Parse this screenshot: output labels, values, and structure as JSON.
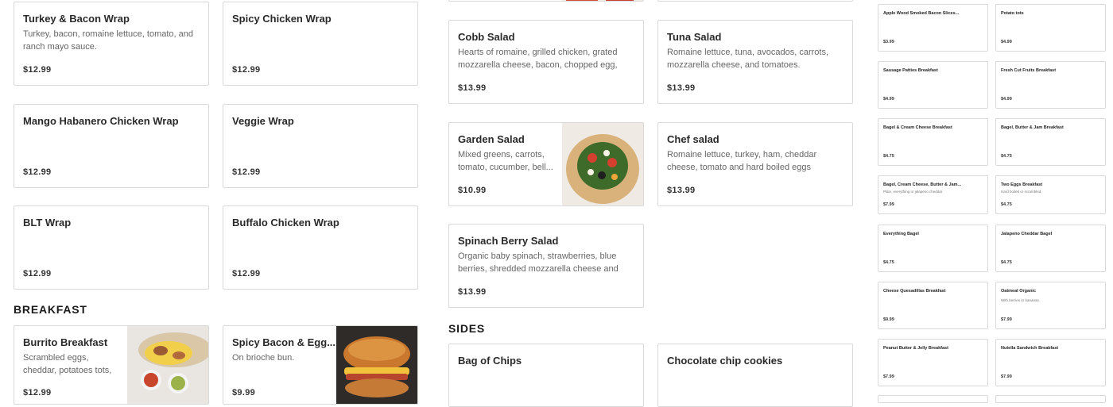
{
  "wraps": [
    {
      "name": "Turkey & Bacon Wrap",
      "desc": "Turkey, bacon, romaine lettuce, tomato, and ranch mayo sauce.",
      "price": "$12.99"
    },
    {
      "name": "Spicy Chicken Wrap",
      "desc": "",
      "price": "$12.99"
    },
    {
      "name": "Mango Habanero Chicken Wrap",
      "desc": "",
      "price": "$12.99"
    },
    {
      "name": "Veggie Wrap",
      "desc": "",
      "price": "$12.99"
    },
    {
      "name": "BLT Wrap",
      "desc": "",
      "price": "$12.99"
    },
    {
      "name": "Buffalo Chicken Wrap",
      "desc": "",
      "price": "$12.99"
    }
  ],
  "breakfast": {
    "heading": "BREAKFAST",
    "items": [
      {
        "name": "Burrito Breakfast",
        "desc": "Scrambled eggs, cheddar, potatoes tots, choice of...",
        "price": "$12.99"
      },
      {
        "name": "Spicy Bacon & Egg...",
        "desc": "On brioche bun.",
        "price": "$9.99"
      }
    ]
  },
  "salads": [
    {
      "name": "Cobb Salad",
      "desc": "Hearts of romaine, grilled chicken, grated mozzarella cheese, bacon, chopped egg, avocad...",
      "price": "$13.99"
    },
    {
      "name": "Tuna Salad",
      "desc": "Romaine lettuce, tuna, avocados, carrots, mozzarella cheese, and tomatoes.",
      "price": "$13.99"
    },
    {
      "name": "Garden Salad",
      "desc": "Mixed greens, carrots, tomato, cucumber, bell...",
      "price": "$10.99"
    },
    {
      "name": "Chef salad",
      "desc": "Romaine lettuce, turkey, ham, cheddar cheese, tomato and hard boiled eggs",
      "price": "$13.99"
    },
    {
      "name": "Spinach Berry Salad",
      "desc": "Organic baby spinach, strawberries, blue berries, shredded mozzarella cheese and almonds.",
      "price": "$13.99"
    }
  ],
  "sides": {
    "heading": "SIDES",
    "items": [
      {
        "name": "Bag of Chips"
      },
      {
        "name": "Chocolate chip cookies"
      }
    ]
  },
  "mini_items": [
    {
      "name": "Apple Wood Smoked Bacon Slices...",
      "desc": "",
      "price": "$3.99"
    },
    {
      "name": "Potato tots",
      "desc": "",
      "price": "$4.99"
    },
    {
      "name": "Sausage Patties Breakfast",
      "desc": "",
      "price": "$4.99"
    },
    {
      "name": "Fresh Cut Fruits Breakfast",
      "desc": "",
      "price": "$4.99"
    },
    {
      "name": "Bagel & Cream Cheese Breakfast",
      "desc": "",
      "price": "$4.75"
    },
    {
      "name": "Bagel, Butter & Jam Breakfast",
      "desc": "",
      "price": "$4.75"
    },
    {
      "name": "Bagel, Cream Cheese, Butter & Jam...",
      "desc": "Plain, everything or jalapeno cheddar.",
      "price": "$7.99"
    },
    {
      "name": "Two Eggs Breakfast",
      "desc": "Hard boiled or scrambled.",
      "price": "$4.75"
    },
    {
      "name": "Everything Bagel",
      "desc": "",
      "price": "$4.75"
    },
    {
      "name": "Jalapeno Cheddar Bagel",
      "desc": "",
      "price": "$4.75"
    },
    {
      "name": "Cheese Quesadillas Breakfast",
      "desc": "",
      "price": "$9.99"
    },
    {
      "name": "Oatmeal Organic",
      "desc": "With berries or bananas.",
      "price": "$7.99"
    },
    {
      "name": "Peanut Butter & Jelly Breakfast",
      "desc": "",
      "price": "$7.99"
    },
    {
      "name": "Nutella Sandwich Breakfast",
      "desc": "",
      "price": "$7.99"
    }
  ]
}
